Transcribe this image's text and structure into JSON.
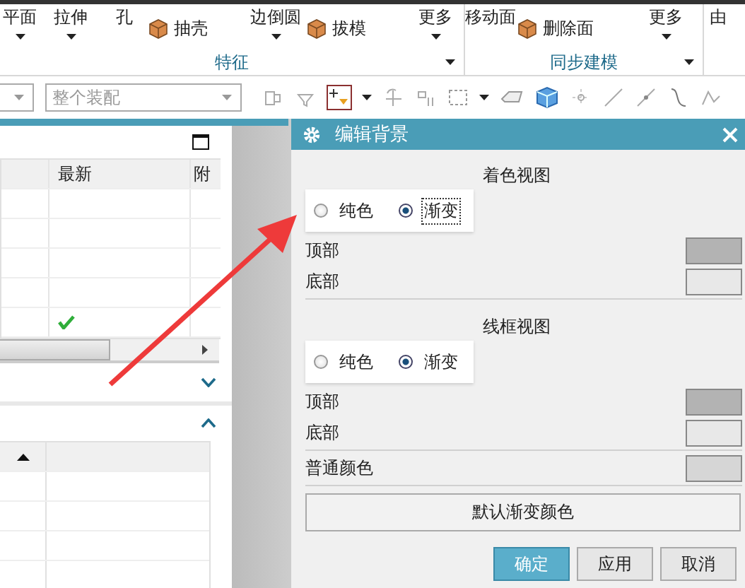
{
  "ribbon": {
    "groups": [
      {
        "label": "特征",
        "items": [
          {
            "kind": "stack",
            "label": "平面",
            "caret": true
          },
          {
            "kind": "stack",
            "label": "拉伸",
            "caret": true
          },
          {
            "kind": "stack",
            "label": "孔",
            "caret": false
          },
          {
            "kind": "icon",
            "label": "抽壳"
          },
          {
            "kind": "stack",
            "label": "边倒圆",
            "caret": true
          },
          {
            "kind": "icon",
            "label": "拔模"
          },
          {
            "kind": "stack",
            "label": "更多",
            "caret": true
          }
        ]
      },
      {
        "label": "同步建模",
        "items": [
          {
            "kind": "stack",
            "label": "移动面",
            "caret": false
          },
          {
            "kind": "icon",
            "label": "删除面"
          },
          {
            "kind": "stack",
            "label": "更多",
            "caret": true
          }
        ]
      },
      {
        "items": [
          {
            "kind": "stack",
            "label": "由",
            "caret": false
          }
        ]
      }
    ]
  },
  "toolbar": {
    "scope_combo": {
      "placeholder": "整个装配"
    }
  },
  "navigator": {
    "columns": [
      {
        "label": "最新"
      },
      {
        "label": "附"
      }
    ],
    "rows": [
      {
        "latest": false
      },
      {
        "latest": false
      },
      {
        "latest": false
      },
      {
        "latest": false
      },
      {
        "latest": true
      }
    ]
  },
  "dialog": {
    "title": "编辑背景",
    "sections": [
      {
        "heading": "着色视图",
        "modes": [
          {
            "label": "纯色",
            "selected": false,
            "focused": false
          },
          {
            "label": "渐变",
            "selected": true,
            "focused": true
          }
        ],
        "colors": [
          {
            "label": "顶部",
            "color": "#b3b3b3"
          },
          {
            "label": "底部",
            "color": "#e8e8e8"
          }
        ]
      },
      {
        "heading": "线框视图",
        "modes": [
          {
            "label": "纯色",
            "selected": false,
            "focused": false
          },
          {
            "label": "渐变",
            "selected": true,
            "focused": false
          }
        ],
        "colors": [
          {
            "label": "顶部",
            "color": "#b3b3b3"
          },
          {
            "label": "底部",
            "color": "#e8e8e8"
          }
        ],
        "extra_colors": [
          {
            "label": "普通颜色",
            "color": "#d6d6d6"
          }
        ]
      }
    ],
    "default_button": "默认渐变颜色",
    "buttons": [
      {
        "label": "确定",
        "kind": "primary"
      },
      {
        "label": "应用",
        "kind": "normal"
      },
      {
        "label": "取消",
        "kind": "normal"
      }
    ]
  }
}
